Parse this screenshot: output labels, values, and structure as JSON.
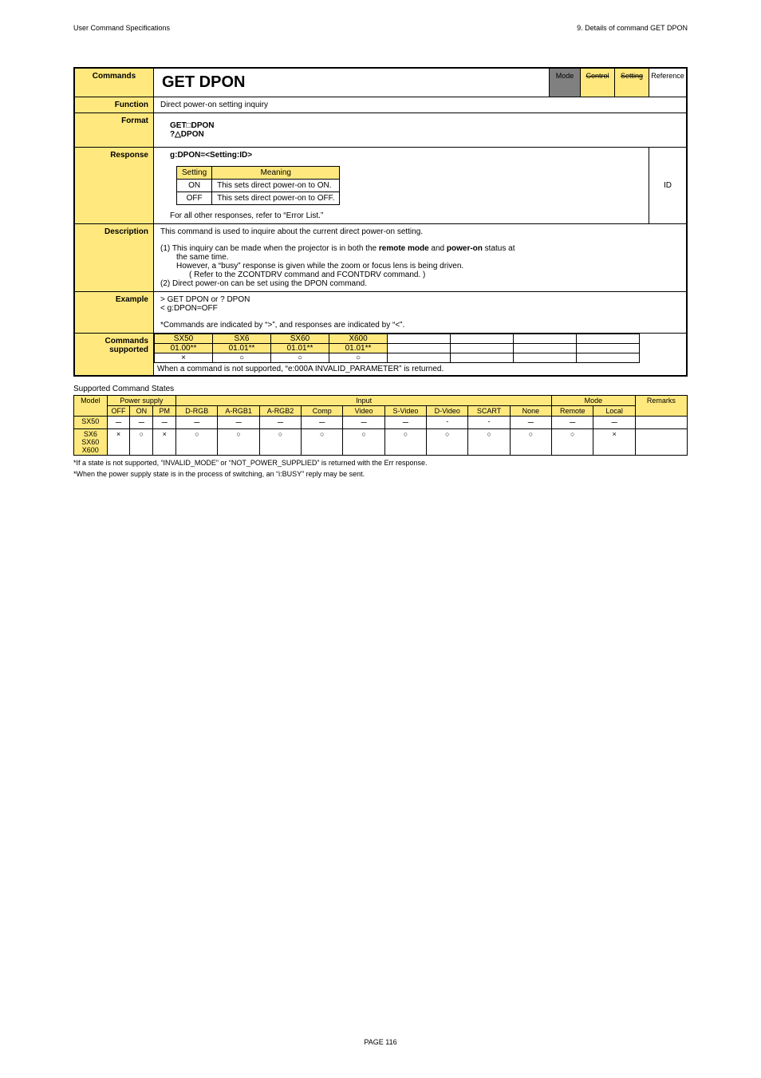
{
  "header": {
    "left": "User Command Specifications",
    "right": "9. Details of command GET DPON"
  },
  "main": {
    "labels": {
      "commands": "Commands",
      "function": "Function",
      "format": "Format",
      "response": "Response",
      "description": "Description",
      "example": "Example",
      "cmdsup": "Commands supported"
    },
    "title": "GET DPON",
    "tags": {
      "mode": "Mode",
      "control": "Control",
      "setting": "Setting",
      "reference": "Reference"
    },
    "function": "Direct power-on setting inquiry",
    "format1": "GET□DPON",
    "format2": "?△DPON",
    "response": {
      "line": "g:DPON=<Setting:ID>",
      "th1": "Setting",
      "th2": "Meaning",
      "r1c1": "ON",
      "r1c2": "This sets direct power-on to ON.",
      "r2c1": "OFF",
      "r2c2": "This sets direct power-on to OFF.",
      "footer": "For all other responses, refer to “Error List.”",
      "id": "ID"
    },
    "description": {
      "d0": "This command is used to inquire about the current direct power-on setting.",
      "d1": "(1) This inquiry can be made when the projector is in both the remote mode and power-on status at the same time.",
      "d1a": "However, a “busy” response is given while the zoom or focus lens is being driven.",
      "d1b": "( Refer to the ZCONTDRV command and FCONTDRV command. )",
      "d2": "(2) Direct power-on can be set using the DPON command."
    },
    "example": {
      "e1": "> GET DPON or ? DPON",
      "e2": "< g:DPON=OFF",
      "note": "*Commands are indicated by “>”, and responses are indicated by “<”."
    },
    "cmdsup": {
      "c1": "SX50",
      "c2": "SX6",
      "c3": "SX60",
      "c4": "X600",
      "v1": "01.00**",
      "v2": "01.01**",
      "v3": "01.01**",
      "v4": "01.01**",
      "s1": "×",
      "s2": "○",
      "s3": "○",
      "s4": "○",
      "note": "When a command is not supported, “e:000A INVALID_PARAMETER” is returned."
    }
  },
  "states": {
    "caption": "Supported Command States",
    "head": {
      "model": "Model",
      "ps": "Power supply",
      "off": "OFF",
      "on": "ON",
      "pm": "PM",
      "input": "Input",
      "drgb": "D-RGB",
      "argb1": "A-RGB1",
      "argb2": "A-RGB2",
      "comp": "Comp",
      "video": "Video",
      "svideo": "S-Video",
      "dvideo": "D-Video",
      "scart": "SCART",
      "none": "None",
      "mode": "Mode",
      "remote": "Remote",
      "local": "Local",
      "remarks": "Remarks"
    },
    "rows": [
      {
        "m": "SX50",
        "c": [
          "ー",
          "ー",
          "ー",
          "ー",
          "ー",
          "ー",
          "ー",
          "ー",
          "ー",
          "-",
          "-",
          "ー",
          "ー",
          "ー",
          ""
        ]
      },
      {
        "m": "SX6",
        "c": [
          "×",
          "○",
          "×",
          "○",
          "○",
          "○",
          "○",
          "○",
          "○",
          "○",
          "○",
          "○",
          "○",
          "×",
          ""
        ]
      },
      {
        "m": "SX60",
        "c": [
          "",
          "",
          "",
          "",
          "",
          "",
          "",
          "",
          "",
          "",
          "",
          "",
          "",
          "",
          ""
        ]
      },
      {
        "m": "X600",
        "c": [
          "",
          "",
          "",
          "",
          "",
          "",
          "",
          "",
          "",
          "",
          "",
          "",
          "",
          "",
          ""
        ]
      }
    ],
    "foot1": "*If a state is not supported, “INVALID_MODE” or “NOT_POWER_SUPPLIED” is returned with the Err response.",
    "foot2": "*When the power supply state is in the process of switching, an “i:BUSY” reply may be sent."
  },
  "page": "PAGE 116"
}
